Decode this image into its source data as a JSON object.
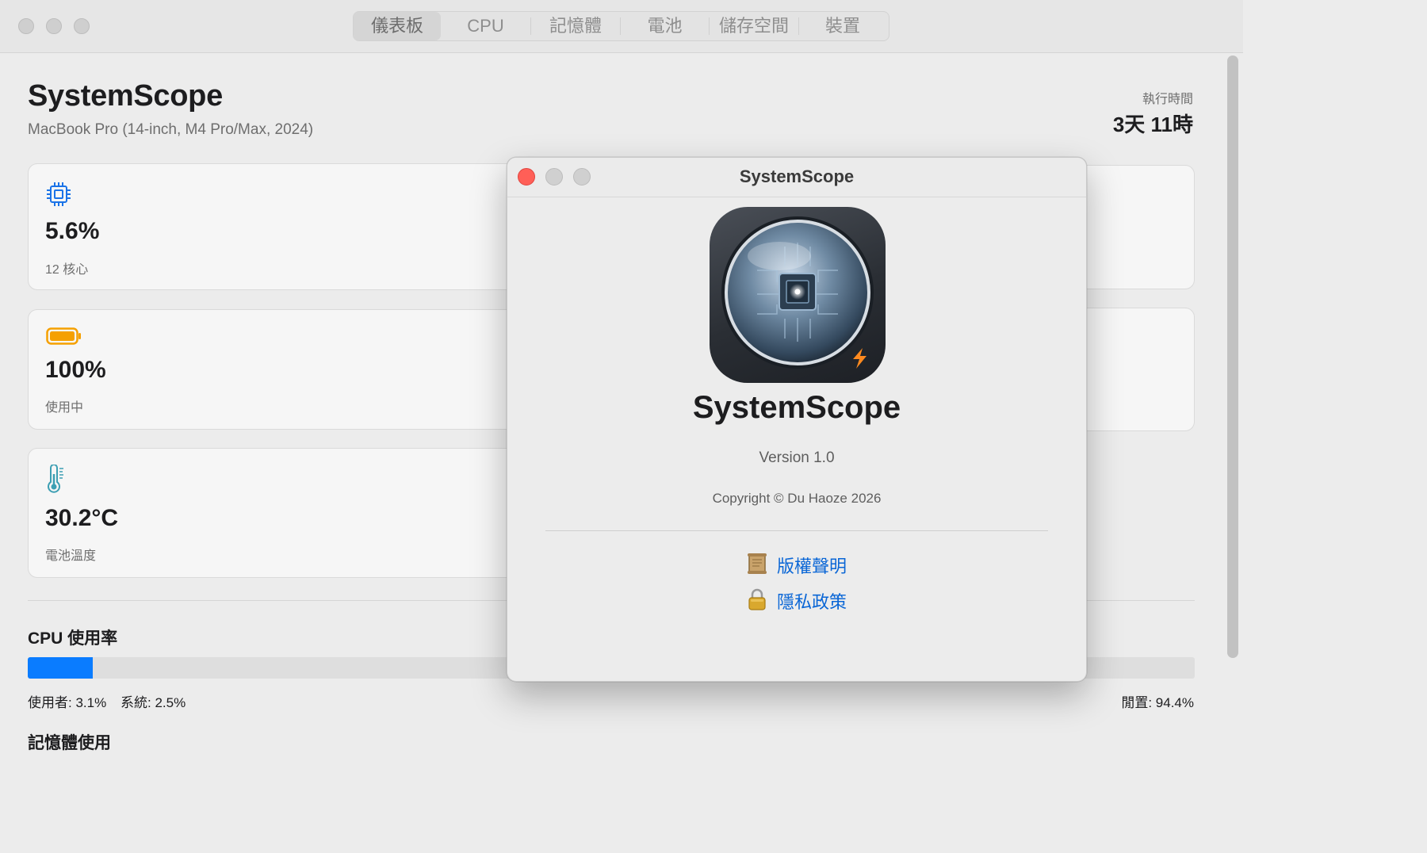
{
  "window": {
    "tabs": [
      {
        "label": "儀表板",
        "active": true
      },
      {
        "label": "CPU",
        "active": false
      },
      {
        "label": "記憶體",
        "active": false
      },
      {
        "label": "電池",
        "active": false
      },
      {
        "label": "儲存空間",
        "active": false
      },
      {
        "label": "裝置",
        "active": false
      }
    ]
  },
  "header": {
    "title": "SystemScope",
    "subtitle": "MacBook Pro (14-inch, M4 Pro/Max, 2024)",
    "uptime_label": "執行時間",
    "uptime_value": "3天 11時"
  },
  "cards": [
    {
      "icon": "cpu-chip-icon",
      "value": "5.6%",
      "sub": "12 核心",
      "accent": "#1a73e8"
    },
    {
      "icon": "battery-icon",
      "value": "100%",
      "sub": "使用中",
      "accent": "#f5a000"
    },
    {
      "icon": "thermometer-icon",
      "value": "30.2°C",
      "sub": "電池溫度",
      "accent": "#3d9fb3"
    }
  ],
  "cpu_usage": {
    "title": "CPU 使用率",
    "used_percent": 5.6,
    "user_text": "使用者: 3.1%",
    "system_text": "系統: 2.5%",
    "idle_text": "閒置: 94.4%",
    "bar_color": "#0a7cff"
  },
  "memory_section": {
    "title": "記憶體使用"
  },
  "about_dialog": {
    "title": "SystemScope",
    "app_name": "SystemScope",
    "version": "Version 1.0",
    "copyright": "Copyright © Du Haoze 2026",
    "links": [
      {
        "icon": "scroll-icon",
        "label": "版權聲明"
      },
      {
        "icon": "lock-icon",
        "label": "隱私政策"
      }
    ],
    "close_color": "#ff5f57"
  }
}
